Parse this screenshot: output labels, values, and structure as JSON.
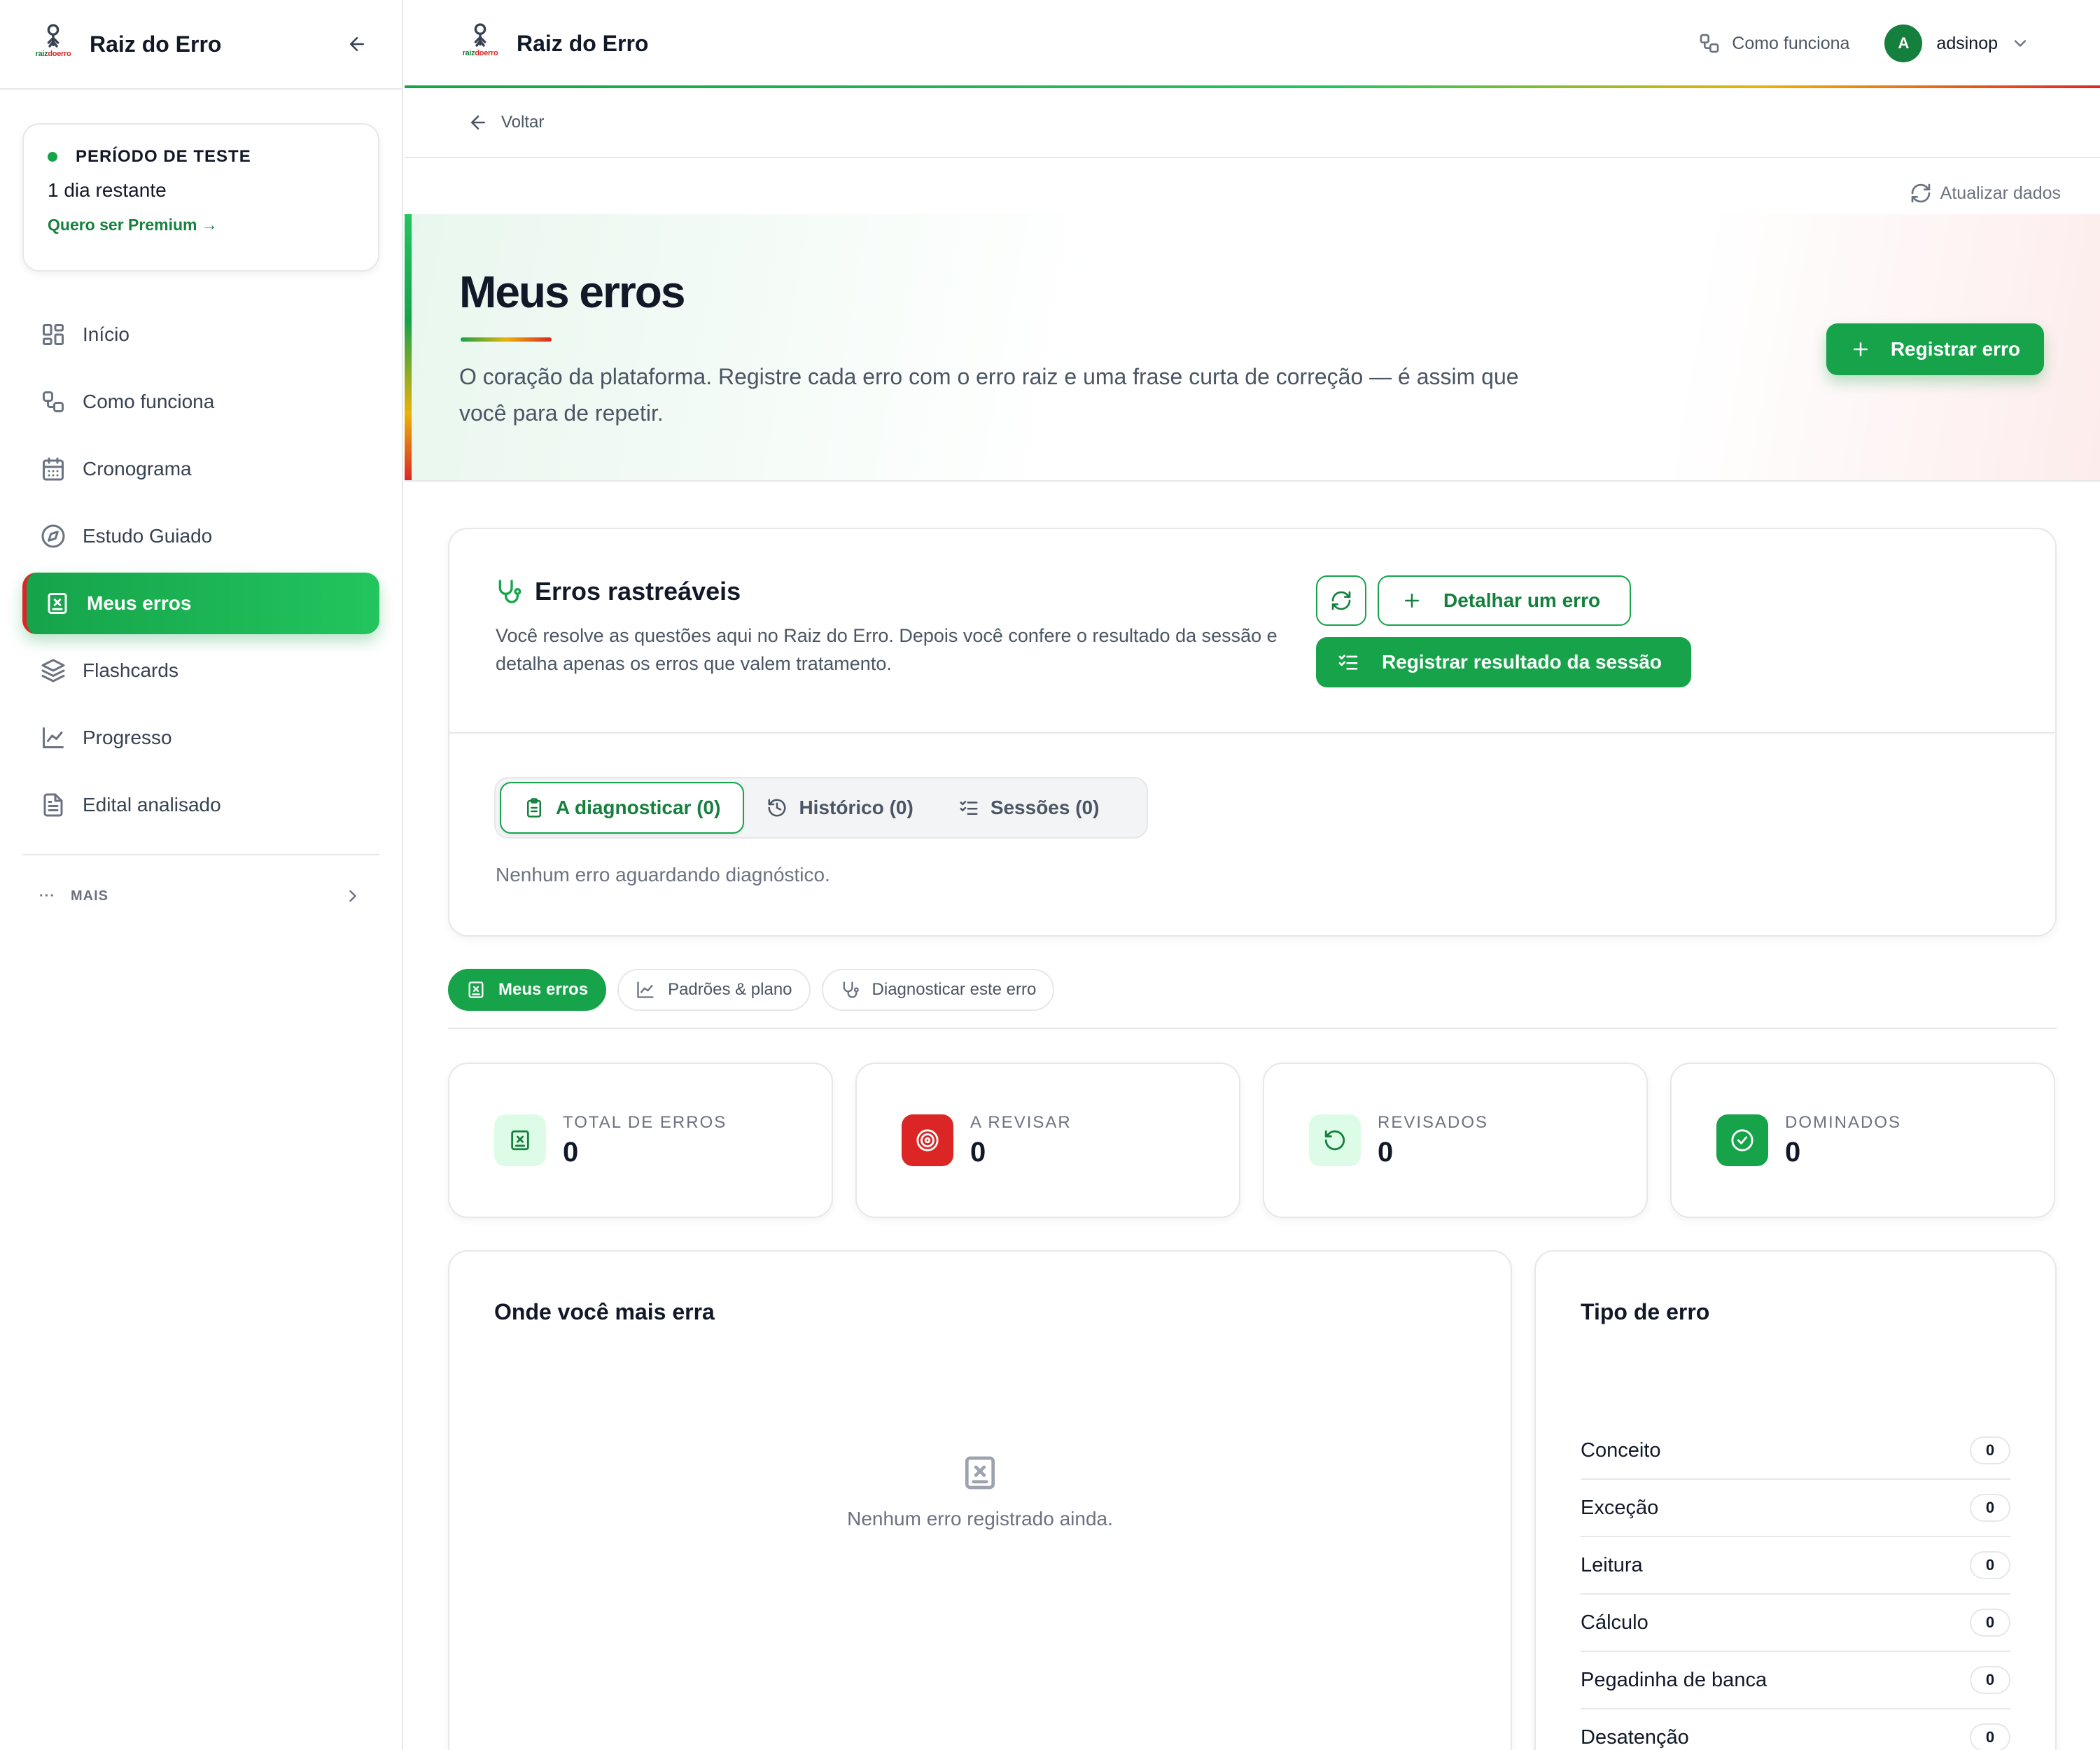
{
  "app": {
    "name": "Raiz do Erro",
    "logo_text_a": "raiz",
    "logo_text_b": "do",
    "logo_text_c": "erro"
  },
  "trial": {
    "title": "PERÍODO DE TESTE",
    "remaining": "1 dia restante",
    "cta": "Quero ser Premium →"
  },
  "sidebar": {
    "items": [
      {
        "label": "Início",
        "icon": "grid-icon",
        "active": false
      },
      {
        "label": "Como funciona",
        "icon": "workflow-icon",
        "active": false
      },
      {
        "label": "Cronograma",
        "icon": "calendar-icon",
        "active": false
      },
      {
        "label": "Estudo Guiado",
        "icon": "compass-icon",
        "active": false
      },
      {
        "label": "Meus erros",
        "icon": "error-book-icon",
        "active": true
      },
      {
        "label": "Flashcards",
        "icon": "layers-icon",
        "active": false
      },
      {
        "label": "Progresso",
        "icon": "line-chart-icon",
        "active": false
      },
      {
        "label": "Edital analisado",
        "icon": "document-icon",
        "active": false
      }
    ],
    "more": {
      "dots": "···",
      "label": "MAIS"
    }
  },
  "topbar": {
    "how_it_works": "Como funciona",
    "avatar_initial": "A",
    "username": "adsinop"
  },
  "back": {
    "label": "Voltar"
  },
  "refresh": {
    "label": "Atualizar dados"
  },
  "hero": {
    "title": "Meus erros",
    "description": "O coração da plataforma. Registre cada erro com o erro raiz e uma frase curta de correção — é assim que você para de repetir.",
    "register_button": "Registrar erro"
  },
  "tracking": {
    "title": "Erros rastreáveis",
    "description": "Você resolve as questões aqui no Raiz do Erro. Depois você confere o resultado da sessão e detalha apenas os erros que valem tratamento.",
    "detail_button": "Detalhar um erro",
    "session_button": "Registrar resultado da sessão",
    "tabs": [
      {
        "label": "A diagnosticar (0)",
        "icon": "clipboard-icon",
        "active": true
      },
      {
        "label": "Histórico (0)",
        "icon": "history-icon",
        "active": false
      },
      {
        "label": "Sessões (0)",
        "icon": "checklist-icon",
        "active": false
      }
    ],
    "empty": "Nenhum erro aguardando diagnóstico."
  },
  "subnav": [
    {
      "label": "Meus erros",
      "icon": "error-book-icon",
      "active": true
    },
    {
      "label": "Padrões & plano",
      "icon": "line-chart-icon",
      "active": false
    },
    {
      "label": "Diagnosticar este erro",
      "icon": "stethoscope-icon",
      "active": false
    }
  ],
  "stats": [
    {
      "label": "TOTAL DE ERROS",
      "value": "0",
      "icon": "error-book-icon",
      "bg": "#dcfce7",
      "fg": "#15803d"
    },
    {
      "label": "A REVISAR",
      "value": "0",
      "icon": "target-icon",
      "bg": "#dc2626",
      "fg": "#ffffff"
    },
    {
      "label": "REVISADOS",
      "value": "0",
      "icon": "rotate-icon",
      "bg": "#dcfce7",
      "fg": "#15803d"
    },
    {
      "label": "DOMINADOS",
      "value": "0",
      "icon": "check-circle-icon",
      "bg": "#16a34a",
      "fg": "#ffffff"
    }
  ],
  "where": {
    "title": "Onde você mais erra",
    "empty": "Nenhum erro registrado ainda."
  },
  "types": {
    "title": "Tipo de erro",
    "rows": [
      {
        "label": "Conceito",
        "count": "0"
      },
      {
        "label": "Exceção",
        "count": "0"
      },
      {
        "label": "Leitura",
        "count": "0"
      },
      {
        "label": "Cálculo",
        "count": "0"
      },
      {
        "label": "Pegadinha de banca",
        "count": "0"
      },
      {
        "label": "Desatenção",
        "count": "0"
      }
    ]
  },
  "colors": {
    "brand_green": "#16a34a",
    "brand_dark_green": "#15803d",
    "brand_red": "#dc2626"
  }
}
